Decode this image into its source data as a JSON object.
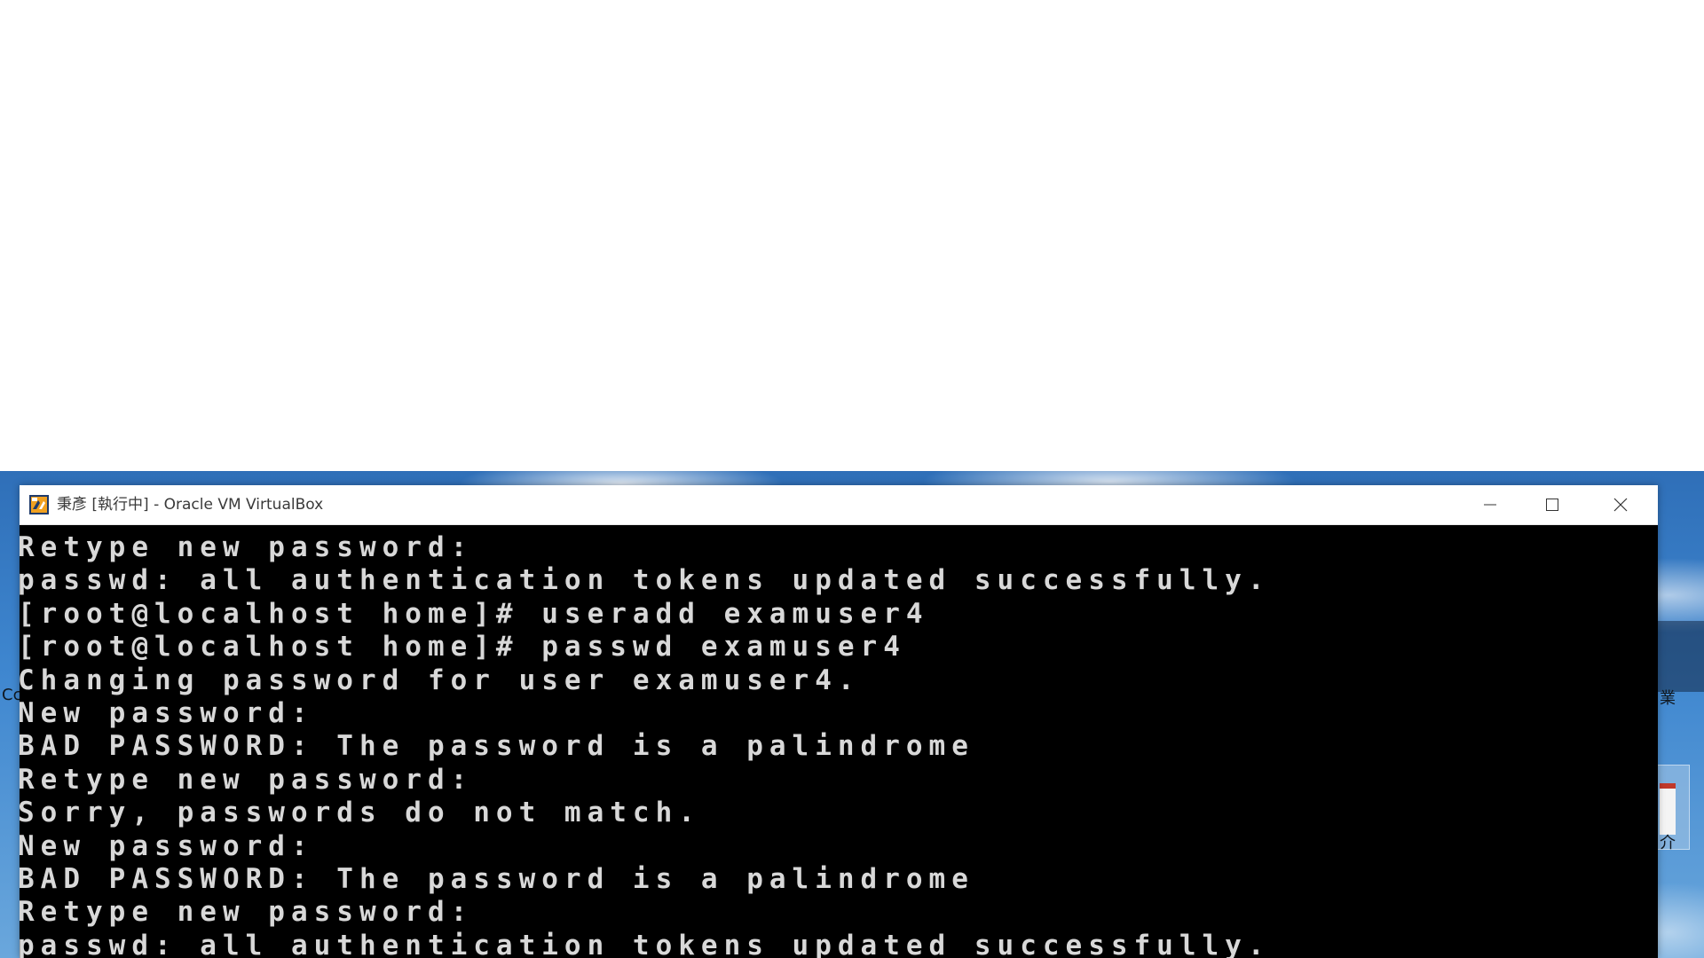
{
  "window": {
    "title": "秉彥 [執行中] - Oracle VM VirtualBox",
    "app_icon": "virtualbox-icon",
    "controls": {
      "minimize_icon": "minimize-icon",
      "maximize_icon": "maximize-icon",
      "close_icon": "close-icon"
    }
  },
  "console": {
    "lines": [
      "Retype new password:",
      "passwd: all authentication tokens updated successfully.",
      "[root@localhost home]# useradd examuser4",
      "[root@localhost home]# passwd examuser4",
      "Changing password for user examuser4.",
      "New password:",
      "BAD PASSWORD: The password is a palindrome",
      "Retype new password:",
      "Sorry, passwords do not match.",
      "New password:",
      "BAD PASSWORD: The password is a palindrome",
      "Retype new password:",
      "passwd: all authentication tokens updated successfully."
    ]
  },
  "desktop": {
    "edge_glyphs": [
      "Cc",
      "業",
      "介"
    ]
  },
  "colors": {
    "console_background": "#000000",
    "console_text": "#d8d8d8",
    "titlebar_background": "#ffffff",
    "desktop_sky": "#3e86cf"
  }
}
